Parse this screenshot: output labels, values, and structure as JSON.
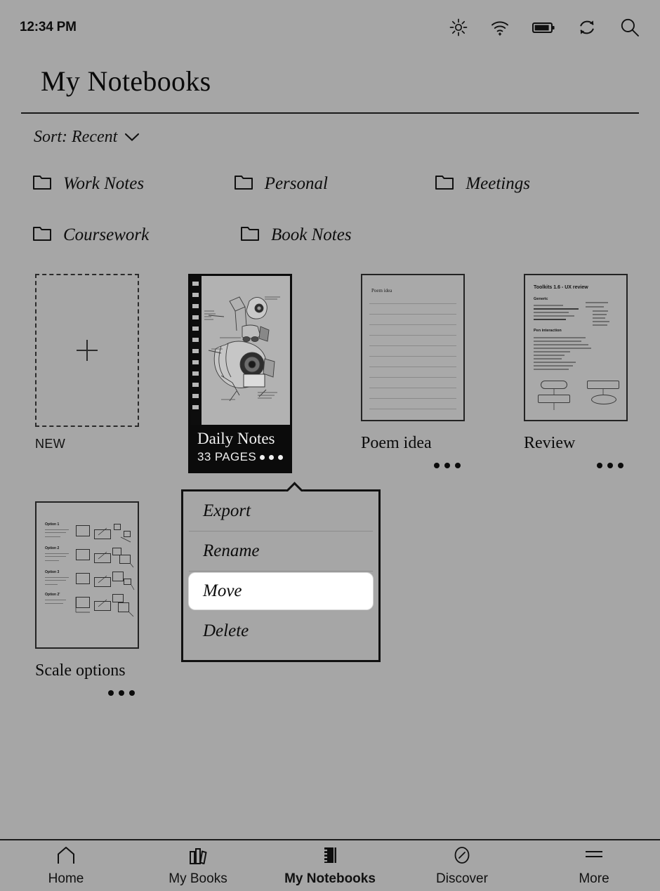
{
  "status_bar": {
    "time": "12:34 PM",
    "icons": [
      "brightness-icon",
      "wifi-icon",
      "battery-icon",
      "sync-icon",
      "search-icon"
    ]
  },
  "header": {
    "title": "My Notebooks"
  },
  "sort": {
    "label": "Sort: Recent",
    "chevron": "chevron-down-icon"
  },
  "folders": [
    {
      "name": "Work Notes"
    },
    {
      "name": "Personal"
    },
    {
      "name": "Meetings"
    },
    {
      "name": "Coursework"
    },
    {
      "name": "Book Notes"
    }
  ],
  "new_tile": {
    "label": "NEW",
    "icon": "plus-icon"
  },
  "notebooks": [
    {
      "title": "Daily Notes",
      "pages": "33 PAGES",
      "selected": true,
      "thumbnail_kind": "sketch"
    },
    {
      "title": "Poem idea",
      "selected": false,
      "thumbnail_kind": "lined-page",
      "thumbnail_heading": "Poem idea"
    },
    {
      "title": "Review",
      "selected": false,
      "thumbnail_kind": "document",
      "thumbnail_heading": "Toolkits 1.6 - UX review",
      "thumbnail_sections": [
        "Generic",
        "Pen interaction"
      ]
    },
    {
      "title": "Scale options",
      "selected": false,
      "thumbnail_kind": "wireframe",
      "thumbnail_options": [
        "Option 1",
        "Option 2",
        "Option 3",
        "Option 2'"
      ]
    }
  ],
  "context_menu": {
    "items": [
      {
        "label": "Export",
        "active": false
      },
      {
        "label": "Rename",
        "active": false
      },
      {
        "label": "Move",
        "active": true
      },
      {
        "label": "Delete",
        "active": false
      }
    ]
  },
  "bottom_nav": [
    {
      "label": "Home",
      "icon": "home-icon",
      "active": false
    },
    {
      "label": "My Books",
      "icon": "books-icon",
      "active": false
    },
    {
      "label": "My Notebooks",
      "icon": "notebook-icon",
      "active": true
    },
    {
      "label": "Discover",
      "icon": "compass-icon",
      "active": false
    },
    {
      "label": "More",
      "icon": "menu-icon",
      "active": false
    }
  ],
  "colors": {
    "background": "#a6a6a6",
    "ink": "#111111",
    "selected_card": "#0b0b0b",
    "highlight": "#ffffff"
  }
}
